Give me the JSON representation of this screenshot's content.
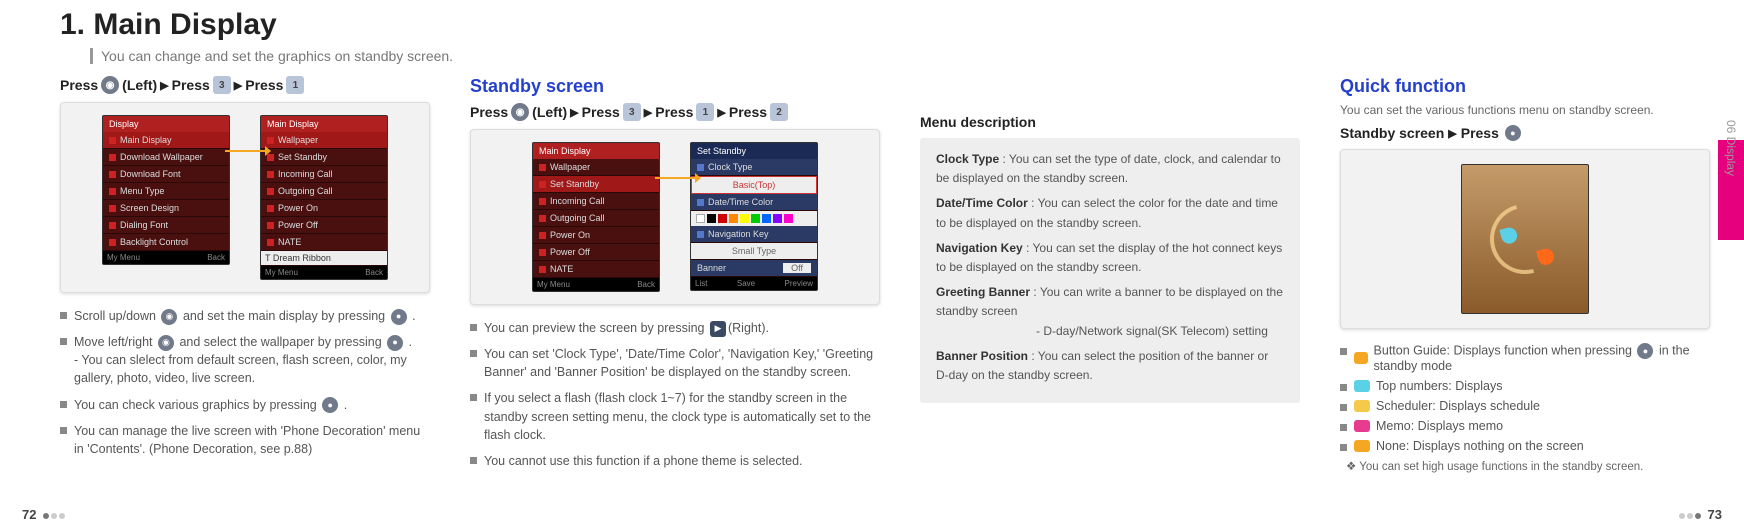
{
  "header": {
    "title": "1. Main Display",
    "subtitle": "You can change and set the graphics on standby screen."
  },
  "side_label": "06 Display",
  "page_left": "72",
  "page_right": "73",
  "col1": {
    "press_parts": [
      "Press",
      "(Left)",
      "▶",
      "Press",
      "▶",
      "Press"
    ],
    "phone1": {
      "header": "Display",
      "rows": [
        "Main Display",
        "Download Wallpaper",
        "Download Font",
        "Menu Type",
        "Screen Design",
        "Dialing Font",
        "Backlight Control"
      ],
      "footer": [
        "My Menu",
        "",
        "Back"
      ]
    },
    "phone2": {
      "header": "Main Display",
      "rows": [
        "Wallpaper",
        "Set Standby",
        "Incoming Call",
        "Outgoing Call",
        "Power On",
        "Power Off",
        "NATE"
      ],
      "wp_caption": "T Dream Ribbon",
      "footer": [
        "My Menu",
        "",
        "Back"
      ]
    },
    "notes": [
      {
        "pre": "Scroll up/down ",
        "mid": " and set the main display by pressing ",
        "post": " ."
      },
      {
        "pre": "Move left/right ",
        "mid": " and select the wallpaper by pressing ",
        "post": " .",
        "sub": "- You can slelect from default screen, flash screen, color, my gallery, photo, video, live screen."
      },
      {
        "pre": "You can check various graphics by pressing ",
        "post": " ."
      },
      {
        "pre": "You can manage the live screen with 'Phone Decoration' menu in 'Contents'. (Phone Decoration, see p.88)"
      }
    ]
  },
  "col2": {
    "section": "Standby screen",
    "press_parts": [
      "Press",
      "(Left)",
      "▶",
      "Press",
      "▶",
      "Press",
      "▶",
      "Press"
    ],
    "phone1": {
      "header": "Main Display",
      "rows": [
        "Wallpaper",
        "Set Standby",
        "Incoming Call",
        "Outgoing Call",
        "Power On",
        "Power Off",
        "NATE"
      ],
      "footer": [
        "My Menu",
        "",
        "Back"
      ]
    },
    "phone2": {
      "header": "Set Standby",
      "rows": [
        {
          "k": "Clock Type",
          "v": ""
        },
        {
          "k": "",
          "v": "Basic(Top)",
          "hl": true
        },
        {
          "k": "Date/Time Color",
          "v": ""
        },
        {
          "k": "swatch",
          "v": ""
        },
        {
          "k": "Navigation Key",
          "v": ""
        },
        {
          "k": "Small Type",
          "v": ""
        },
        {
          "k": "Banner",
          "v": "Off"
        }
      ],
      "footer": [
        "List",
        "Save",
        "Preview"
      ]
    },
    "notes": [
      "You can preview the screen by pressing (Right).",
      "You can set 'Clock Type', 'Date/Time Color', 'Navigation Key,' 'Greeting Banner' and 'Banner Position' be displayed on the standby screen.",
      "If you select a flash (flash clock 1~7) for the standby screen in the standby screen setting menu, the clock type is automatically set to the flash clock.",
      "You cannot use this function if a phone theme is selected."
    ]
  },
  "col3": {
    "title": "Menu description",
    "items": [
      {
        "term": "Clock Type",
        "desc": ": You can set the type of date, clock, and calendar to be displayed on the standby screen."
      },
      {
        "term": "Date/Time Color",
        "desc": ": You can select the color for the date and time to be displayed on the standby screen."
      },
      {
        "term": "Navigation Key",
        "desc": ": You can set the display of the hot connect keys to be displayed on the standby screen."
      },
      {
        "term": "Greeting Banner",
        "desc": ": You can write a banner to be displayed on the standby screen",
        "extra": "- D-day/Network signal(SK Telecom) setting"
      },
      {
        "term": "Banner Position",
        "desc": ": You can select the position of the banner or D-day on the standby screen."
      }
    ]
  },
  "col4": {
    "section": "Quick function",
    "desc": "You can set the various functions menu on standby screen.",
    "standby_line": [
      "Standby screen",
      "▶",
      "Press"
    ],
    "qf_items": [
      {
        "icon": "a",
        "text": "Button Guide: Displays function when pressing ",
        "post": " in the standby mode"
      },
      {
        "icon": "b",
        "text": "Top numbers: Displays"
      },
      {
        "icon": "c",
        "text": "Scheduler: Displays schedule"
      },
      {
        "icon": "d",
        "text": "Memo: Displays memo"
      },
      {
        "icon": "e",
        "text": "None: Displays nothing on the screen"
      }
    ],
    "tip": "You can set high usage functions in the standby screen."
  }
}
